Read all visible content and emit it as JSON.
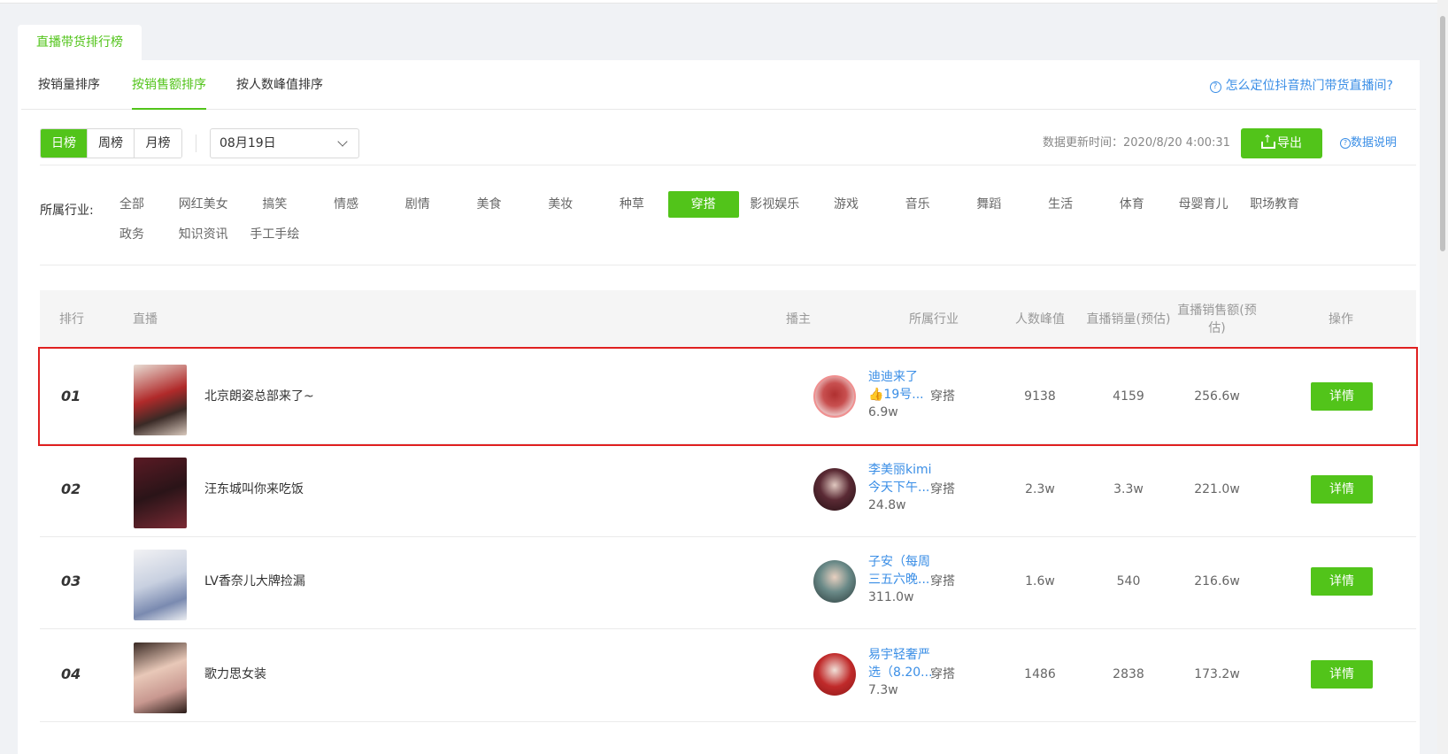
{
  "page_tab": "直播带货排行榜",
  "sort_tabs": [
    "按销量排序",
    "按销售额排序",
    "按人数峰值排序"
  ],
  "active_sort_tab": 1,
  "help_link": "怎么定位抖音热门带货直播间?",
  "help_icon": "question-circle-icon",
  "periods": [
    "日榜",
    "周榜",
    "月榜"
  ],
  "active_period": 0,
  "date_value": "08月19日",
  "update_time": "数据更新时间：2020/8/20 4:00:31",
  "export_label": "导出",
  "export_icon": "export-icon",
  "data_note": "数据说明",
  "industry_label": "所属行业:",
  "industries": [
    "全部",
    "网红美女",
    "搞笑",
    "情感",
    "剧情",
    "美食",
    "美妆",
    "种草",
    "穿搭",
    "影视娱乐",
    "游戏",
    "音乐",
    "舞蹈",
    "生活",
    "体育",
    "母婴育儿",
    "职场教育",
    "政务",
    "知识资讯",
    "手工手绘"
  ],
  "active_industry": "穿搭",
  "table": {
    "headers": {
      "rank": "排行",
      "live": "直播",
      "host": "播主",
      "industry": "所属行业",
      "peak": "人数峰值",
      "sales_volume": "直播销量(预估)",
      "sales_amount": "直播销售额(预估)",
      "action": "操作"
    },
    "detail_label": "详情",
    "rows": [
      {
        "rank": "01",
        "title": "北京朗姿总部来了~",
        "host_line1": "迪迪来了",
        "host_line2": "👍19号...",
        "fans": "6.9w",
        "industry": "穿搭",
        "peak": "9138",
        "sales_volume": "4159",
        "sales_amount": "256.6w"
      },
      {
        "rank": "02",
        "title": "汪东城叫你来吃饭",
        "host_line1": "李美丽kimi",
        "host_line2": "今天下午...",
        "fans": "24.8w",
        "industry": "穿搭",
        "peak": "2.3w",
        "sales_volume": "3.3w",
        "sales_amount": "221.0w"
      },
      {
        "rank": "03",
        "title": "LV香奈儿大牌捡漏",
        "host_line1": "子安（每周",
        "host_line2": "三五六晚...",
        "fans": "311.0w",
        "industry": "穿搭",
        "peak": "1.6w",
        "sales_volume": "540",
        "sales_amount": "216.6w"
      },
      {
        "rank": "04",
        "title": "歌力思女装",
        "host_line1": "易宇轻奢严",
        "host_line2": "选（8.20...",
        "fans": "7.3w",
        "industry": "穿搭",
        "peak": "1486",
        "sales_volume": "2838",
        "sales_amount": "173.2w"
      }
    ]
  },
  "colors": {
    "accent": "#52c41a",
    "link": "#3a8ee6",
    "highlight_border": "#e02020"
  }
}
